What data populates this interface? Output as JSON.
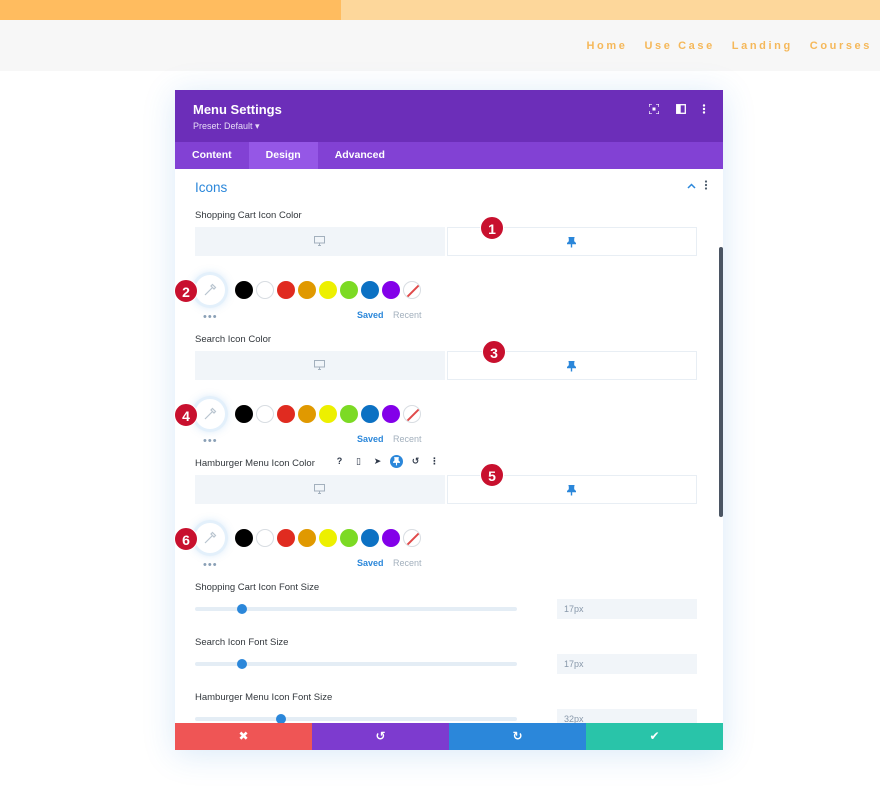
{
  "nav": {
    "items": [
      "Home",
      "Use Case",
      "Landing",
      "Courses"
    ]
  },
  "modal": {
    "title": "Menu Settings",
    "preset": "Preset: Default ▾",
    "tabs": [
      "Content",
      "Design",
      "Advanced"
    ],
    "active_tab": "Design",
    "section_title": "Icons",
    "fields": {
      "cart_color_label": "Shopping Cart Icon Color",
      "search_color_label": "Search Icon Color",
      "hamburger_color_label": "Hamburger Menu Icon Color",
      "cart_size_label": "Shopping Cart Icon Font Size",
      "search_size_label": "Search Icon Font Size",
      "hamburger_size_label": "Hamburger Menu Icon Font Size",
      "cart_size_value": "17px",
      "search_size_value": "17px",
      "hamburger_size_value": "32px"
    },
    "swatches": [
      "#000000",
      "#ffffff",
      "#e02b20",
      "#e09900",
      "#edf000",
      "#7cda24",
      "#0c71c3",
      "#8300e9"
    ],
    "saved_label": "Saved",
    "recent_label": "Recent",
    "dots": "•••",
    "mini_icons": [
      "?",
      "▯",
      "➤",
      "📌",
      "↺",
      "⋮"
    ]
  },
  "footer": {
    "cancel": "✖",
    "undo": "↺",
    "redo": "↻",
    "save": "✔",
    "colors": {
      "cancel": "#ef5555",
      "undo": "#7d3bcf",
      "redo": "#2b87da",
      "save": "#29c4a9"
    }
  },
  "markers": [
    "1",
    "2",
    "3",
    "4",
    "5",
    "6"
  ],
  "colors": {
    "accent": "#2b87da",
    "header": "#6c2eb9",
    "tabs": "#8241d4",
    "marker": "#c8102e"
  }
}
